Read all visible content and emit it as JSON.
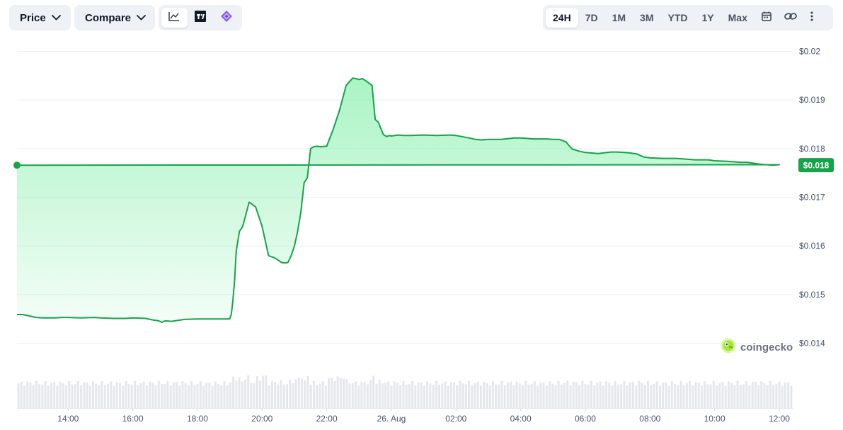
{
  "toolbar": {
    "price_label": "Price",
    "compare_label": "Compare",
    "chart_types": [
      {
        "name": "line-chart-icon",
        "active": true
      },
      {
        "name": "tradingview-icon",
        "active": false
      },
      {
        "name": "diamond-icon",
        "active": false
      }
    ],
    "ranges": [
      "24H",
      "7D",
      "1M",
      "3M",
      "YTD",
      "1Y",
      "Max"
    ],
    "active_range": "24H",
    "icons": [
      "calendar-icon",
      "link-icon",
      "more-vertical-icon"
    ]
  },
  "watermark": {
    "text": "coingecko",
    "icon": "gecko-logo-icon"
  },
  "colors": {
    "line": "#16a34a",
    "fill": "#86efac",
    "badge": "#16a34a",
    "volume": "#e5e7eb",
    "grid": "#eceff3"
  },
  "chart_data": {
    "type": "area",
    "title": "",
    "xlabel": "",
    "ylabel": "",
    "ylim": [
      0.014,
      0.02
    ],
    "yticks": [
      0.014,
      0.015,
      0.016,
      0.017,
      0.018,
      0.019,
      0.02
    ],
    "ytick_labels": [
      "$0.014",
      "$0.015",
      "$0.016",
      "$0.017",
      "$0.018",
      "$0.019",
      "$0.02"
    ],
    "xlim": [
      "12:25",
      "12:25+1d"
    ],
    "xticks": [
      "14:00",
      "16:00",
      "18:00",
      "20:00",
      "22:00",
      "26. Aug",
      "02:00",
      "04:00",
      "06:00",
      "08:00",
      "10:00",
      "12:00"
    ],
    "grid": true,
    "last_price_label": "$0.018",
    "series": [
      {
        "x": [
          "12:25",
          "12:36",
          "12:48",
          "13:00",
          "13:12",
          "13:24",
          "13:36",
          "13:48",
          "14:00",
          "14:24",
          "14:48",
          "15:00",
          "15:24",
          "15:48",
          "16:00",
          "16:24",
          "16:36",
          "16:48",
          "16:54",
          "17:00",
          "17:12",
          "17:36",
          "18:00",
          "18:24",
          "18:36",
          "18:48",
          "18:54",
          "19:00",
          "19:03",
          "19:06",
          "19:09",
          "19:12",
          "19:18",
          "19:24",
          "19:36",
          "19:48",
          "20:00",
          "20:12",
          "20:24",
          "20:36",
          "20:42",
          "20:48",
          "20:54",
          "21:00",
          "21:06",
          "21:12",
          "21:18",
          "21:24",
          "21:30",
          "21:36",
          "21:42",
          "21:48",
          "22:00",
          "22:12",
          "22:24",
          "22:36",
          "22:48",
          "22:54",
          "23:00",
          "23:06",
          "23:12",
          "23:24",
          "23:30",
          "23:36",
          "23:39",
          "23:45",
          "23:51",
          "23:57",
          "00:00",
          "00:12",
          "00:24",
          "00:36",
          "01:00",
          "01:24",
          "01:48",
          "02:00",
          "02:24",
          "02:36",
          "02:48",
          "03:00",
          "03:24",
          "03:48",
          "04:00",
          "04:24",
          "04:48",
          "05:00",
          "05:12",
          "05:24",
          "05:30",
          "05:36",
          "05:48",
          "06:00",
          "06:24",
          "06:48",
          "07:00",
          "07:12",
          "07:24",
          "07:36",
          "07:48",
          "08:00",
          "08:24",
          "08:48",
          "09:00",
          "09:24",
          "09:48",
          "10:00",
          "10:24",
          "10:48",
          "11:00",
          "11:24",
          "11:48",
          "12:00",
          "12:25"
        ],
        "values": [
          0.01459,
          0.01459,
          0.01456,
          0.01453,
          0.01452,
          0.01452,
          0.01452,
          0.01453,
          0.01453,
          0.01452,
          0.01453,
          0.01452,
          0.01451,
          0.01451,
          0.01452,
          0.01451,
          0.01448,
          0.01446,
          0.01443,
          0.01446,
          0.01445,
          0.01449,
          0.0145,
          0.0145,
          0.0145,
          0.0145,
          0.0145,
          0.0145,
          0.0146,
          0.0149,
          0.0153,
          0.0159,
          0.0163,
          0.0164,
          0.0169,
          0.0168,
          0.0164,
          0.0158,
          0.01575,
          0.01566,
          0.01565,
          0.01566,
          0.0158,
          0.016,
          0.0163,
          0.0167,
          0.0173,
          0.0174,
          0.018,
          0.01804,
          0.01805,
          0.01804,
          0.01805,
          0.0184,
          0.0188,
          0.0193,
          0.01945,
          0.01944,
          0.01942,
          0.01944,
          0.0194,
          0.0193,
          0.0186,
          0.01854,
          0.01845,
          0.01829,
          0.01825,
          0.01827,
          0.01826,
          0.01828,
          0.01827,
          0.01827,
          0.01828,
          0.01827,
          0.01828,
          0.01827,
          0.01822,
          0.01819,
          0.01818,
          0.01819,
          0.01819,
          0.01822,
          0.01822,
          0.0182,
          0.0182,
          0.01819,
          0.01819,
          0.01814,
          0.01806,
          0.01799,
          0.01795,
          0.01792,
          0.0179,
          0.01793,
          0.01793,
          0.01792,
          0.01791,
          0.01789,
          0.01783,
          0.01781,
          0.0178,
          0.0178,
          0.01779,
          0.01777,
          0.01777,
          0.01775,
          0.01774,
          0.01772,
          0.01772,
          0.01768,
          0.01766,
          0.01767,
          0.01766
        ]
      }
    ]
  }
}
